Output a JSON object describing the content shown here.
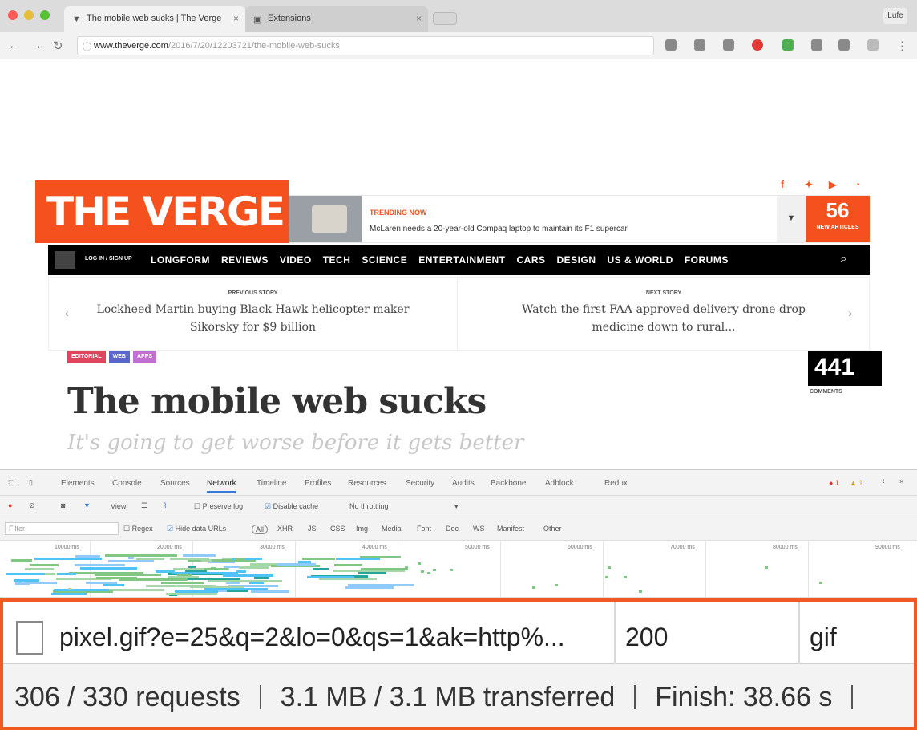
{
  "browser": {
    "tabs": [
      {
        "title": "The mobile web sucks | The Verge"
      },
      {
        "title": "Extensions"
      }
    ],
    "profile": "Lufe",
    "url_host": "www.theverge.com",
    "url_path": "/2016/7/20/12203721/the-mobile-web-sucks"
  },
  "site": {
    "logo": "THE VERGE",
    "trending_label": "TRENDING NOW",
    "trending_text": "McLaren needs a 20-year-old Compaq laptop to maintain its F1 supercar",
    "trending_count": "56",
    "trending_count_label": "NEW ARTICLES",
    "nav_signin": "LOG IN / SIGN UP",
    "nav_items": [
      "LONGFORM",
      "REVIEWS",
      "VIDEO",
      "TECH",
      "SCIENCE",
      "ENTERTAINMENT",
      "CARS",
      "DESIGN",
      "US & WORLD",
      "FORUMS"
    ],
    "prev_kicker": "PREVIOUS STORY",
    "prev_title": "Lockheed Martin buying Black Hawk helicopter maker Sikorsky for $9 billion",
    "next_kicker": "NEXT STORY",
    "next_title": "Watch the first FAA-approved delivery drone drop medicine down to rural...",
    "tags": [
      "EDITORIAL",
      "WEB",
      "APPS"
    ],
    "headline": "The mobile web sucks",
    "subhead": "It's going to get worse before it gets better",
    "comment_count": "441",
    "comment_label": "COMMENTS"
  },
  "devtools": {
    "tabs": [
      "Elements",
      "Console",
      "Sources",
      "Network",
      "Timeline",
      "Profiles",
      "Resources",
      "Security",
      "Audits",
      "Backbone",
      "Adblock",
      "Redux"
    ],
    "active_tab": "Network",
    "errors": "1",
    "warnings": "1",
    "toolbar_view": "View:",
    "preserve_log": "Preserve log",
    "disable_cache": "Disable cache",
    "throttling": "No throttling",
    "filter_placeholder": "Filter",
    "regex": "Regex",
    "hide_data_urls": "Hide data URLs",
    "filter_types": [
      "All",
      "XHR",
      "JS",
      "CSS",
      "Img",
      "Media",
      "Font",
      "Doc",
      "WS",
      "Manifest",
      "Other"
    ],
    "ticks": [
      "10000 ms",
      "20000 ms",
      "30000 ms",
      "40000 ms",
      "50000 ms",
      "60000 ms",
      "70000 ms",
      "80000 ms",
      "90000 ms"
    ],
    "row": {
      "name": "pixel.gif?e=25&q=2&lo=0&qs=1&ak=http%...",
      "status": "200",
      "type": "gif"
    },
    "summary": {
      "requests": "306 / 330 requests",
      "transferred": "3.1 MB / 3.1 MB transferred",
      "finish": "Finish: 38.66 s"
    }
  }
}
